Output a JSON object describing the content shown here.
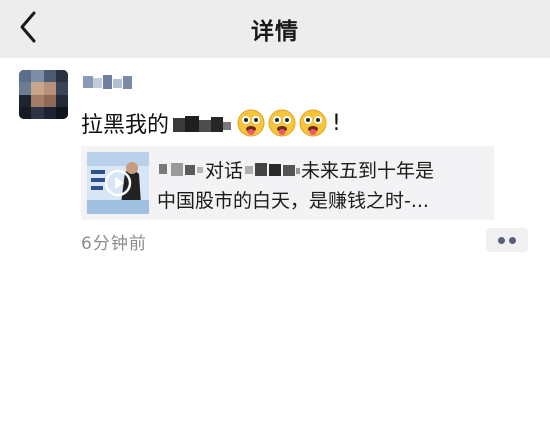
{
  "navbar": {
    "title": "详情",
    "back_icon": "chevron-left-icon"
  },
  "post": {
    "author_name": "",
    "text_prefix": "拉黑我的",
    "text_suffix": "!",
    "emoji_name": "tongue-out-emoji",
    "emoji_count": 3,
    "link": {
      "title_part1": "对话",
      "title_part2": "未来五到十年是",
      "title_line2": "中国股市的白天，是赚钱之时-..."
    },
    "timestamp": "6分钟前",
    "more_icon": "more-dots-icon"
  }
}
